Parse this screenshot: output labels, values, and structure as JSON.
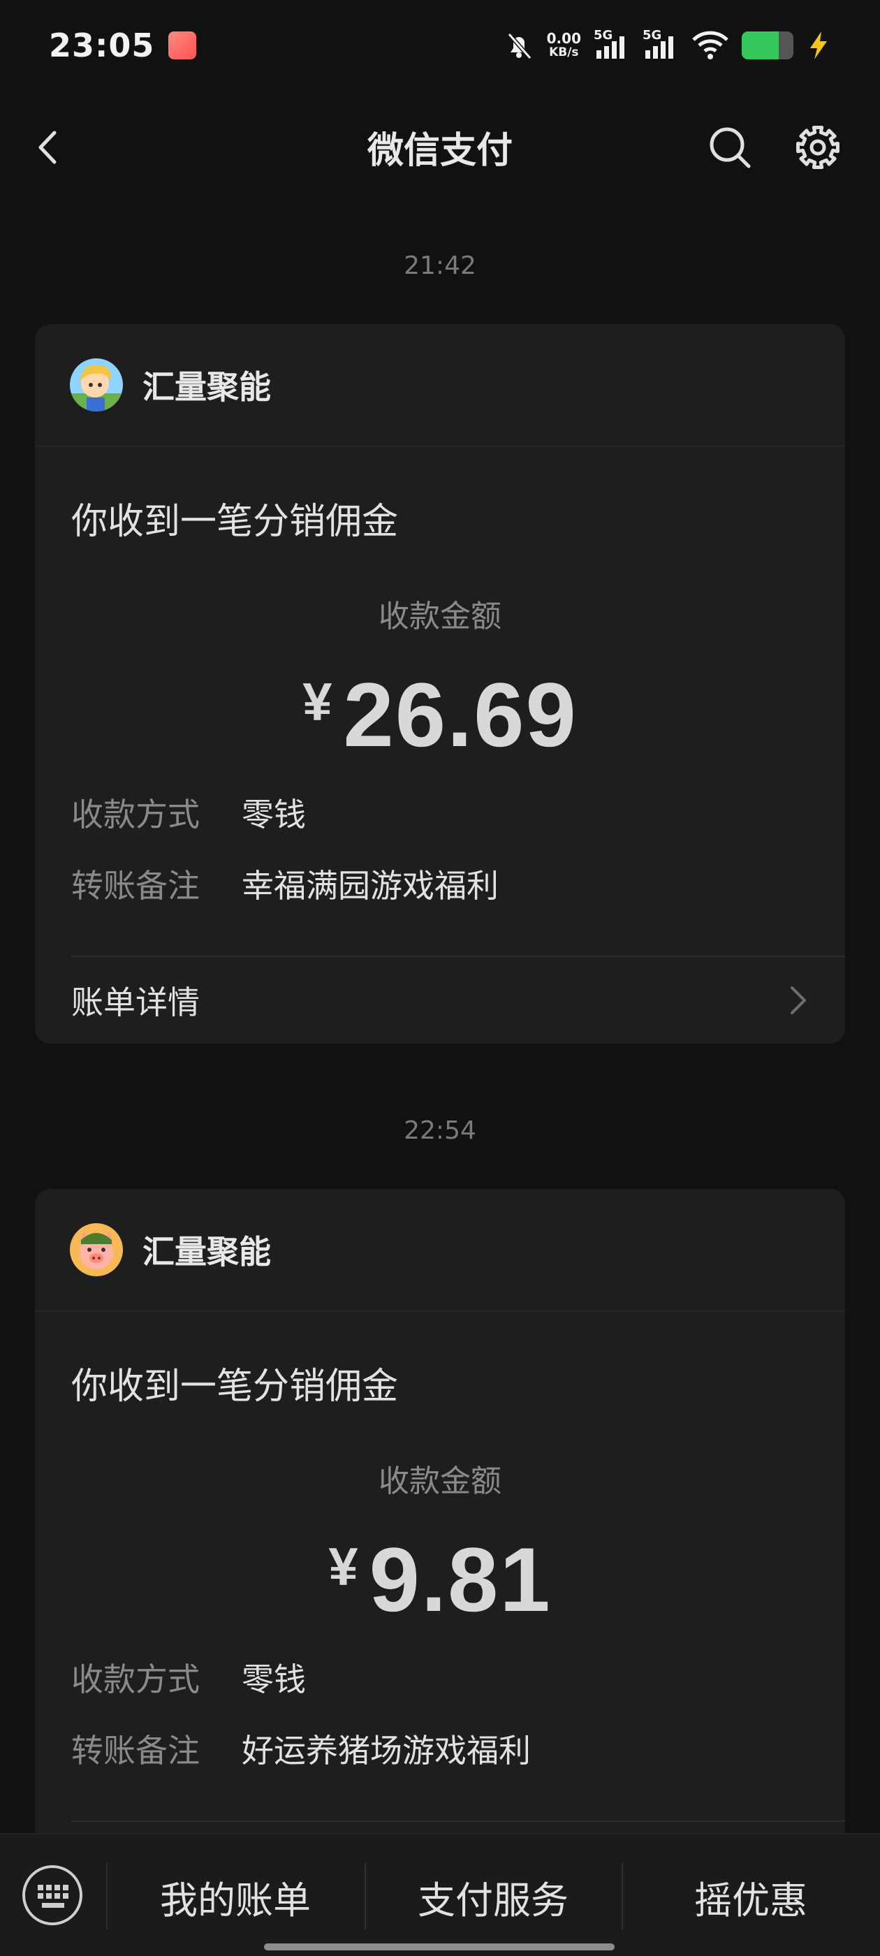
{
  "status_bar": {
    "time": "23:05",
    "net_speed_value": "0.00",
    "net_speed_unit": "KB/s",
    "sim1": "5G",
    "sim2": "5G",
    "battery_level": 0.72,
    "battery_color": "#35c759"
  },
  "nav": {
    "title": "微信支付",
    "back_icon": "chevron-left-icon",
    "search_icon": "search-icon",
    "settings_icon": "gear-icon"
  },
  "messages": [
    {
      "time": "21:42",
      "sender": "汇量聚能",
      "heading": "你收到一笔分销佣金",
      "amount_label": "收款金额",
      "currency": "¥",
      "amount": "26.69",
      "method_key": "收款方式",
      "method_val": "零钱",
      "note_key": "转账备注",
      "note_val": "幸福满园游戏福利",
      "detail_label": "账单详情"
    },
    {
      "time": "22:54",
      "sender": "汇量聚能",
      "heading": "你收到一笔分销佣金",
      "amount_label": "收款金额",
      "currency": "¥",
      "amount": "9.81",
      "method_key": "收款方式",
      "method_val": "零钱",
      "note_key": "转账备注",
      "note_val": "好运养猪场游戏福利"
    }
  ],
  "bottom_menu": {
    "keyboard_icon": "keyboard-icon",
    "items": [
      "我的账单",
      "支付服务",
      "摇优惠"
    ]
  }
}
